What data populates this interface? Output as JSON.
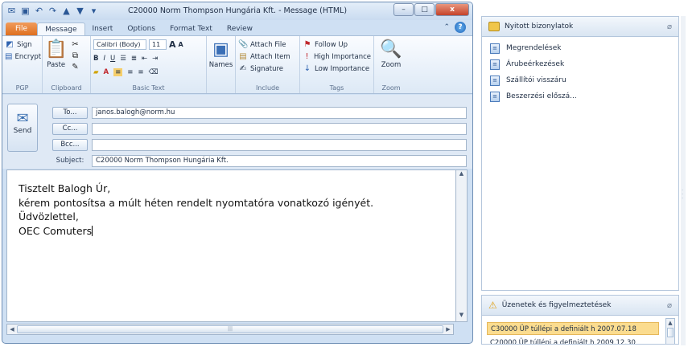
{
  "window": {
    "title": "C20000 Norm Thompson Hungária Kft. - Message (HTML)",
    "quick_access": [
      "save-icon",
      "undo-icon",
      "redo-icon"
    ],
    "controls": {
      "minimize": "–",
      "maximize": "□",
      "close": "x"
    }
  },
  "tabs": [
    {
      "label": "File"
    },
    {
      "label": "Message"
    },
    {
      "label": "Insert"
    },
    {
      "label": "Options"
    },
    {
      "label": "Format Text"
    },
    {
      "label": "Review"
    }
  ],
  "ribbon": {
    "pgp": {
      "sign": "Sign",
      "encrypt": "Encrypt",
      "label": "PGP"
    },
    "clipboard": {
      "paste": "Paste",
      "label": "Clipboard"
    },
    "basic_text": {
      "font": "Calibri (Body)",
      "size": "11",
      "grow": "A",
      "shrink": "A",
      "bold": "B",
      "italic": "I",
      "underline": "U",
      "label": "Basic Text"
    },
    "names": {
      "label": "Names"
    },
    "include": {
      "attach_file": "Attach File",
      "attach_item": "Attach Item",
      "signature": "Signature",
      "label": "Include"
    },
    "tags": {
      "follow_up": "Follow Up",
      "high": "High Importance",
      "low": "Low Importance",
      "label": "Tags"
    },
    "zoom": {
      "button": "Zoom",
      "label": "Zoom"
    }
  },
  "form": {
    "send": "Send",
    "to_label": "To...",
    "to_value": "janos.balogh@norm.hu",
    "cc_label": "Cc...",
    "cc_value": "",
    "bcc_label": "Bcc...",
    "bcc_value": "",
    "subject_label": "Subject:",
    "subject_value": "C20000 Norm Thompson Hungária Kft."
  },
  "body": {
    "line1": "Tisztelt Balogh Úr,",
    "line2": "kérem pontosítsa a múlt héten rendelt nyomtatóra vonatkozó igényét.",
    "line3": "Üdvözlettel,",
    "line4": "OEC Comuters"
  },
  "side_panel": {
    "title": "Nyitott bizonylatok",
    "items": [
      "Megrendelések",
      "Árubeérkezések",
      "Szállítói visszáru",
      "Beszerzési előszá..."
    ]
  },
  "alerts_panel": {
    "title": "Üzenetek és figyelmeztetések",
    "items": [
      "C30000 ÜP túllépi a definiált h 2007.07.18",
      "C20000 ÜP túllépi a definiált h 2009.12.30"
    ]
  }
}
